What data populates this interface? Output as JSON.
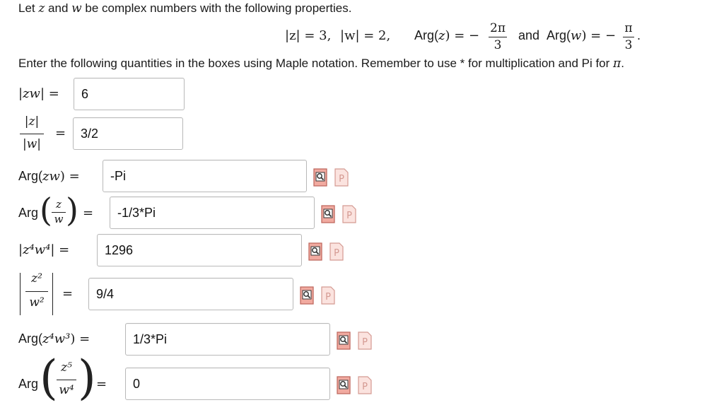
{
  "intro": {
    "pre": "Let ",
    "z": "z",
    "and": " and ",
    "w": "w",
    "post": " be complex numbers with the following properties."
  },
  "props": {
    "abs_z": "|z| = 3,",
    "abs_w": "|w| = 2,",
    "arg_z_pre": "Arg(",
    "arg_z_var": "z",
    "arg_z_post": ") = −",
    "arg_z_num": "2π",
    "arg_z_den": "3",
    "and": "and",
    "arg_w_pre": "Arg(",
    "arg_w_var": "w",
    "arg_w_post": ") = −",
    "arg_w_num": "π",
    "arg_w_den": "3",
    "period": "."
  },
  "instructions": {
    "text": "Enter the following quantities in the boxes using Maple notation. Remember to use * for multiplication and Pi for ",
    "pi": "π",
    "end": "."
  },
  "questions": [
    {
      "label": "|zw| =",
      "answer": "6"
    },
    {
      "num": "|z|",
      "den": "|w|",
      "eq": "=",
      "answer": "3/2"
    },
    {
      "label_pre": "Arg(",
      "label_var": "zw",
      "label_post": ") =",
      "answer": "-Pi"
    },
    {
      "arg": "Arg",
      "num": "z",
      "den": "w",
      "eq": "=",
      "answer": "-1/3*Pi"
    },
    {
      "label": "|z⁴w⁴| =",
      "answer": "1296"
    },
    {
      "num": "z²",
      "den": "w²",
      "eq": "=",
      "answer": "9/4"
    },
    {
      "label_pre": "Arg(",
      "label_var": "z⁴w³",
      "label_post": ") =",
      "answer": "1/3*Pi"
    },
    {
      "arg": "Arg",
      "num": "z⁵",
      "den": "w⁴",
      "eq": "=",
      "answer": "0"
    }
  ],
  "icons": {
    "preview": "preview-icon",
    "preview_letter": "P",
    "preview_color": "#e89a8e",
    "help_color": "#f3c4bc"
  }
}
